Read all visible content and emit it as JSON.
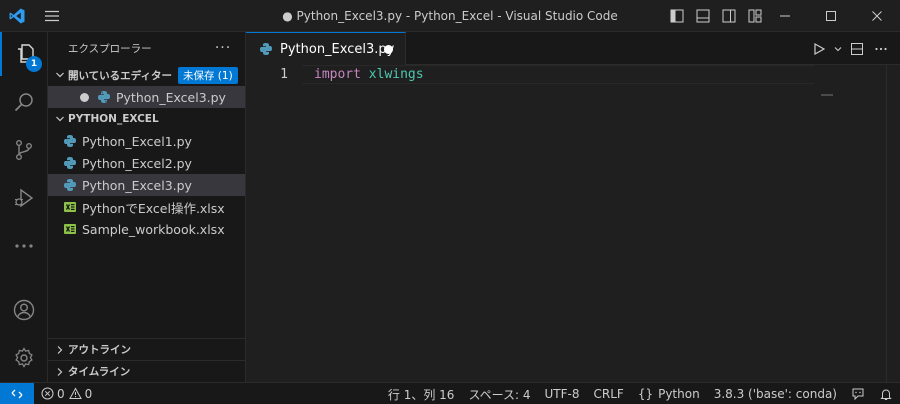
{
  "window": {
    "title": "● Python_Excel3.py - Python_Excel - Visual Studio Code"
  },
  "activity_bar": {
    "explorer_badge": "1"
  },
  "sidebar": {
    "header": "エクスプローラー",
    "more": "···",
    "open_editors": {
      "label": "開いているエディター",
      "unsaved_badge": "未保存 (1)",
      "items": [
        {
          "name": "Python_Excel3.py"
        }
      ]
    },
    "folder": {
      "label": "PYTHON_EXCEL",
      "files": [
        {
          "name": "Python_Excel1.py",
          "type": "python"
        },
        {
          "name": "Python_Excel2.py",
          "type": "python"
        },
        {
          "name": "Python_Excel3.py",
          "type": "python"
        },
        {
          "name": "PythonでExcel操作.xlsx",
          "type": "excel"
        },
        {
          "name": "Sample_workbook.xlsx",
          "type": "excel"
        }
      ]
    },
    "outline": "アウトライン",
    "timeline": "タイムライン"
  },
  "editor": {
    "tab_label": "Python_Excel3.py",
    "line_number": "1",
    "code": {
      "keyword": "import",
      "module": "xlwings"
    }
  },
  "status_bar": {
    "errors": "0",
    "warnings": "0",
    "position": "行 1、列 16",
    "spaces": "スペース: 4",
    "encoding": "UTF-8",
    "eol": "CRLF",
    "language": "Python",
    "interpreter": "3.8.3 ('base': conda)"
  },
  "colors": {
    "accent": "#0078d4",
    "python_icon": "#519aba",
    "excel_icon": "#8dc149",
    "keyword": "#c586c0",
    "module": "#4ec9b0"
  }
}
